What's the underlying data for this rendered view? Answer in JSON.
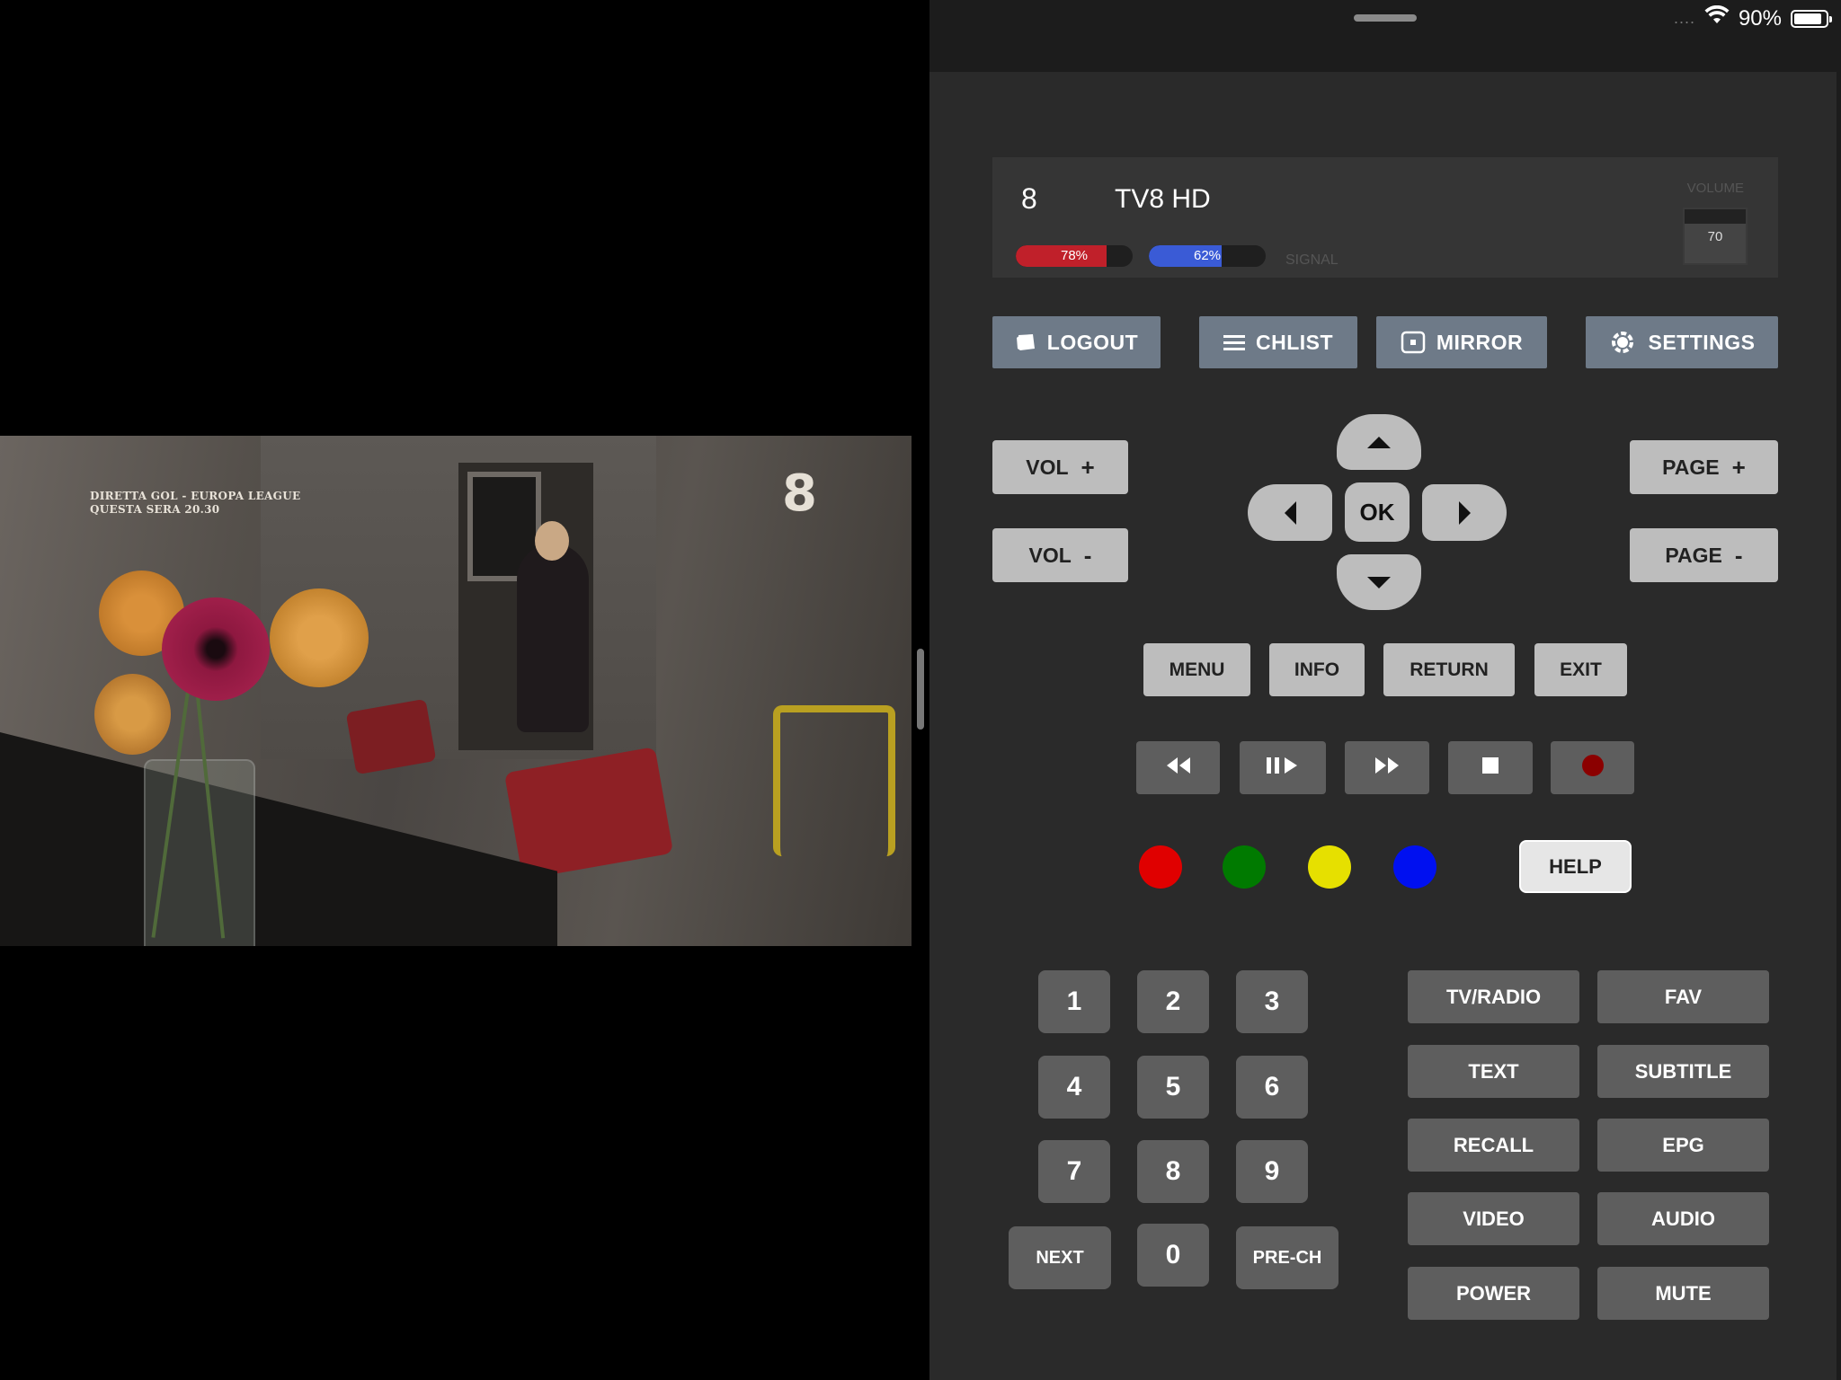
{
  "status_bar": {
    "dots": "....",
    "battery_text": "90%",
    "battery_level": 0.9
  },
  "video": {
    "overlay_line1": "DIRETTA GOL - EUROPA LEAGUE",
    "overlay_line2": "QUESTA SERA 20.30",
    "logo": "8"
  },
  "info": {
    "channel_number": "8",
    "channel_name": "TV8 HD",
    "strength_label": "78%",
    "strength_level": 0.78,
    "quality_label": "62%",
    "quality_level": 0.62,
    "signal_label": "SIGNAL",
    "volume_label": "VOLUME",
    "volume_value": "70",
    "colors": {
      "strength": "#c0202a",
      "quality": "#3a5bd6"
    }
  },
  "top_buttons": {
    "logout": "LOGOUT",
    "chlist": "CHLIST",
    "mirror": "MIRROR",
    "settings": "SETTINGS"
  },
  "vol_page": {
    "vol_label": "VOL",
    "page_label": "PAGE",
    "plus": "+",
    "minus": "-"
  },
  "dpad": {
    "ok": "OK"
  },
  "menu_row": {
    "menu": "MENU",
    "info": "INFO",
    "return": "RETURN",
    "exit": "EXIT"
  },
  "color_keys": {
    "red": "#e00000",
    "green": "#007a00",
    "yellow": "#e6e000",
    "blue": "#0010f0",
    "help": "HELP"
  },
  "numpad": {
    "digits": [
      "1",
      "2",
      "3",
      "4",
      "5",
      "6",
      "7",
      "8",
      "9",
      "0"
    ],
    "next": "NEXT",
    "prech": "PRE-CH"
  },
  "functions": {
    "tvradio": "TV/RADIO",
    "fav": "FAV",
    "text": "TEXT",
    "subtitle": "SUBTITLE",
    "recall": "RECALL",
    "epg": "EPG",
    "video": "VIDEO",
    "audio": "AUDIO",
    "power": "POWER",
    "mute": "MUTE"
  }
}
